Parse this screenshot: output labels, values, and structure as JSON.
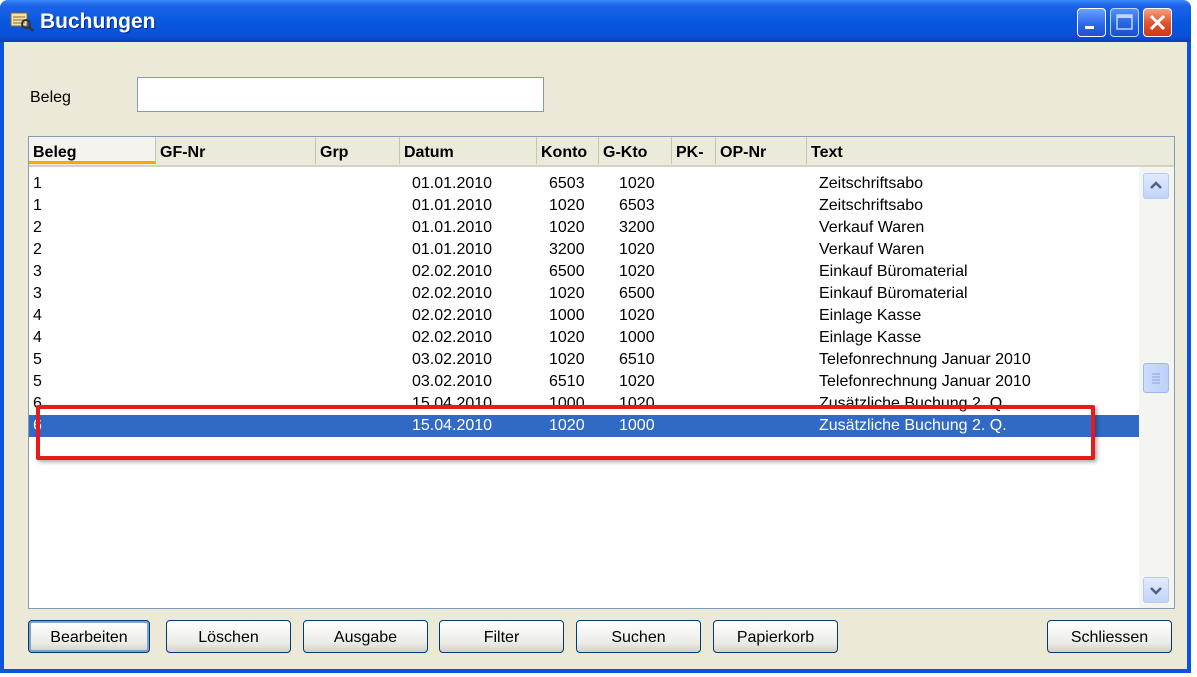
{
  "window": {
    "title": "Buchungen"
  },
  "form": {
    "beleg_label": "Beleg",
    "beleg_value": ""
  },
  "columns": [
    "Beleg",
    "GF-Nr",
    "Grp",
    "Datum",
    "Konto",
    "G-Kto",
    "PK-",
    "OP-Nr",
    "Text"
  ],
  "rows": [
    {
      "beleg": "1",
      "datum": "01.01.2010",
      "konto": "6503",
      "gkto": "1020",
      "text": "Zeitschriftsabo"
    },
    {
      "beleg": "1",
      "datum": "01.01.2010",
      "konto": "1020",
      "gkto": "6503",
      "text": "Zeitschriftsabo"
    },
    {
      "beleg": "2",
      "datum": "01.01.2010",
      "konto": "1020",
      "gkto": "3200",
      "text": "Verkauf Waren"
    },
    {
      "beleg": "2",
      "datum": "01.01.2010",
      "konto": "3200",
      "gkto": "1020",
      "text": "Verkauf Waren"
    },
    {
      "beleg": "3",
      "datum": "02.02.2010",
      "konto": "6500",
      "gkto": "1020",
      "text": "Einkauf Büromaterial"
    },
    {
      "beleg": "3",
      "datum": "02.02.2010",
      "konto": "1020",
      "gkto": "6500",
      "text": "Einkauf Büromaterial"
    },
    {
      "beleg": "4",
      "datum": "02.02.2010",
      "konto": "1000",
      "gkto": "1020",
      "text": "Einlage Kasse"
    },
    {
      "beleg": "4",
      "datum": "02.02.2010",
      "konto": "1020",
      "gkto": "1000",
      "text": "Einlage Kasse"
    },
    {
      "beleg": "5",
      "datum": "03.02.2010",
      "konto": "1020",
      "gkto": "6510",
      "text": "Telefonrechnung Januar 2010"
    },
    {
      "beleg": "5",
      "datum": "03.02.2010",
      "konto": "6510",
      "gkto": "1020",
      "text": "Telefonrechnung Januar 2010"
    },
    {
      "beleg": "6",
      "datum": "15.04.2010",
      "konto": "1000",
      "gkto": "1020",
      "text": "Zusätzliche Buchung 2. Q."
    },
    {
      "beleg": "6",
      "datum": "15.04.2010",
      "konto": "1020",
      "gkto": "1000",
      "text": "Zusätzliche Buchung 2. Q.",
      "selected": true
    }
  ],
  "buttons": {
    "bearbeiten": "Bearbeiten",
    "loeschen": "Löschen",
    "ausgabe": "Ausgabe",
    "filter": "Filter",
    "suchen": "Suchen",
    "papierkorb": "Papierkorb",
    "schliessen": "Schliessen"
  },
  "colors": {
    "selection": "#316ac5",
    "highlight_box": "#e51b1b",
    "titlebar": "#0858e0"
  }
}
